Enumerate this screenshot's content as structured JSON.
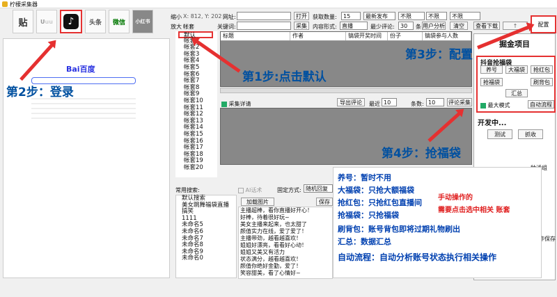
{
  "app": {
    "title": "柠檬采集器"
  },
  "platforms": [
    {
      "label": "贴"
    },
    {
      "label": "tiktok"
    },
    {
      "label": "头条"
    },
    {
      "label": "微信"
    },
    {
      "label": "小红书"
    }
  ],
  "view": {
    "shrink": "缩小",
    "enlarge": "放大"
  },
  "coords": "X: 812, Y: 202",
  "account": {
    "label": "帐套",
    "items": [
      "默认",
      "帐套1",
      "帐套2",
      "帐套3",
      "帐套4",
      "帐套5",
      "帐套6",
      "帐套7",
      "帐套8",
      "帐套9",
      "帐套10",
      "帐套11",
      "帐套12",
      "帐套13",
      "帐套14",
      "帐套15",
      "帐套16",
      "帐套17",
      "帐套18",
      "帐套19",
      "帐套20"
    ]
  },
  "form": {
    "url_label": "网址:",
    "keyword_label": "关键词:",
    "open": "打开",
    "collect": "采集",
    "fetch_label": "获取数量:",
    "fetch_value": "15",
    "content_label": "内容形式:",
    "content_value": "直播",
    "sort_value": "最新发布",
    "min_comment_label": "最少评论:",
    "min_comment_value": "30",
    "unit": "条",
    "limit1": "不限",
    "limit2": "不限",
    "limit3": "不限",
    "user_analysis": "用户分析",
    "clear": "清空",
    "view_download": "查看下载",
    "config": "配置"
  },
  "grid": {
    "columns": [
      "标题",
      "作者",
      "镐袋开奖时间",
      "份子",
      "镐袋参与人数"
    ]
  },
  "detail": {
    "checkbox": "采集详请",
    "export": "导出评论",
    "recent_label": "最近",
    "recent_value": "10",
    "count_label": "条数:",
    "count_value": "10",
    "comment_collect": "评论采集"
  },
  "common_search": {
    "label": "常用搜索:",
    "items": [
      "默认搜索",
      "美女跳舞福袋直播",
      "搞笑",
      "1111",
      "未命名5",
      "未命名6",
      "未命名7",
      "未命名8",
      "未命名9",
      "未命名0"
    ]
  },
  "auto_reply": {
    "checkbox": "AI话术",
    "fixed_label": "固定方式:",
    "fixed_value": "随机回复",
    "add_image": "加载图片",
    "save": "保存",
    "messages": [
      "主播超棒，看你直播好开心！",
      "好棒，待着很好玩~",
      "美女主播来起来，也太甜了",
      "颜值实力在线，爱了爱了！",
      "主播带劲，越看越喜欢！",
      "姐姐好漂亮，看看好心动！",
      "姐姐又美又有活力",
      "状态满分，越看越喜欢！",
      "颜值你绝好金勤，爱了！",
      "笑容甜美，看了心情好~"
    ]
  },
  "right_panel": {
    "title": "掘金项目",
    "section": "抖音抢福袋",
    "buttons": [
      "养号",
      "大福袋",
      "抢红包",
      "抢福袋",
      "刷背包",
      "汇总",
      "自动流程"
    ],
    "max_mode": "最大模式",
    "dev_title": "开发中...",
    "test": "测试",
    "grab": "抓收",
    "group": "种活组",
    "save_partial": "作保存"
  },
  "annotations": {
    "step1": "第1步:点击默认",
    "step2": "第2步：登录",
    "step3": "第3步：配置",
    "step4": "第4步：抢福袋"
  },
  "notes": {
    "lines": [
      "养号：暂时不用",
      "大福袋：只抢大额福袋",
      "抢红包：只抢红包直播间",
      "抢福袋：只抢福袋",
      "刷背包：账号背包即将过期礼物刷出",
      "汇总：数据汇总",
      "自动流程：自动分析账号状态执行相关操作"
    ],
    "manual1": "手动操作的",
    "manual2": "需要点击选中相关  账套"
  },
  "browser": {
    "logo": "Bai百度"
  },
  "colors": {
    "annotation_red": "#e53030",
    "step_blue": "#0050a0",
    "note_red": "#e02020"
  }
}
